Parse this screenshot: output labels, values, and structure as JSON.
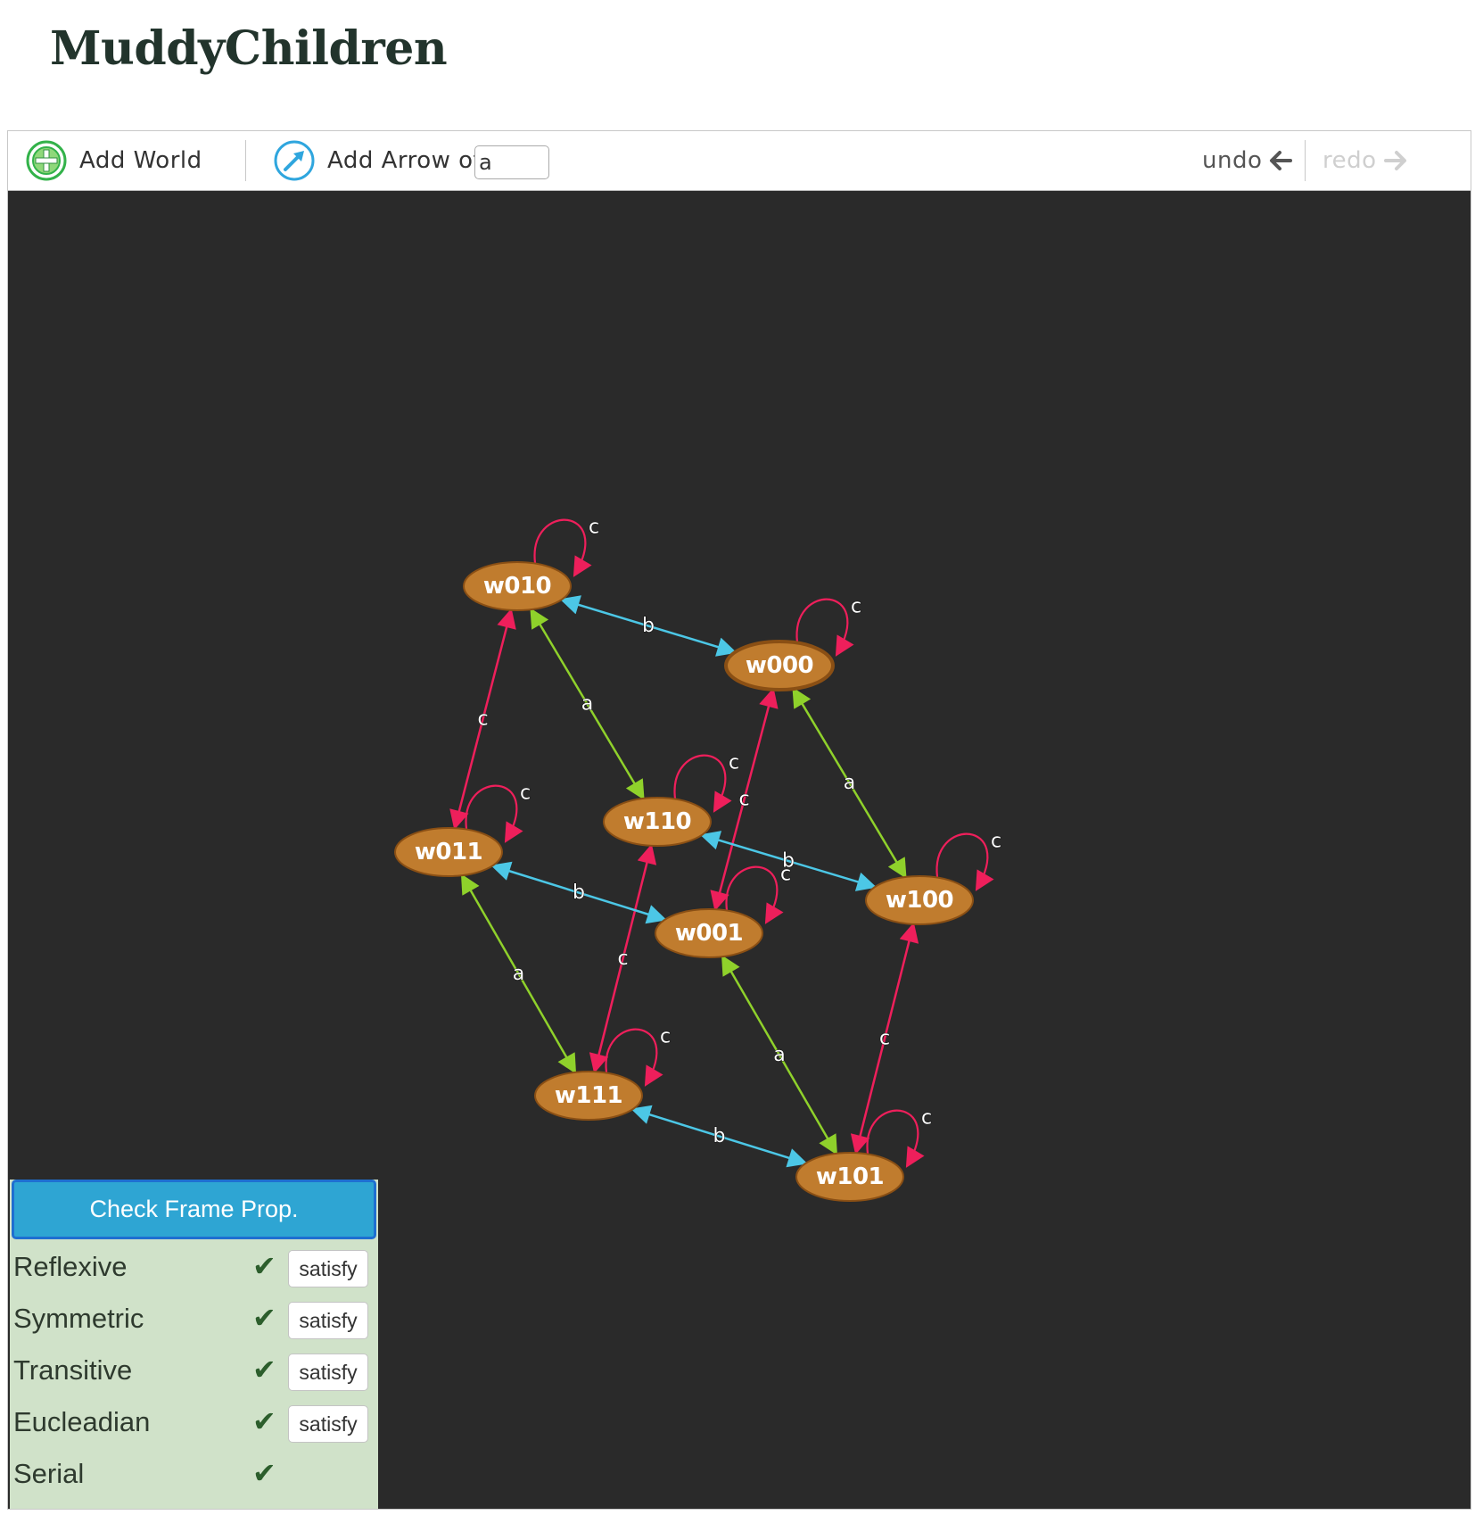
{
  "page": {
    "title": "MuddyChildren"
  },
  "toolbar": {
    "add_world_label": "Add World",
    "add_arrow_label": "Add Arrow of",
    "arrow_label_value": "a",
    "undo_label": "undo",
    "redo_label": "redo"
  },
  "colors": {
    "canvas_bg": "#2a2a2a",
    "world_fill": "#c07c2e",
    "world_stroke": "#8a4f14",
    "agent_a": "#8fd12b",
    "agent_b": "#4cc7e6",
    "agent_c": "#ee1f5b",
    "panel_bg": "#d0e2c9",
    "check_button": "#2ea5d3"
  },
  "graph": {
    "worlds": [
      {
        "id": "w010",
        "label": "w010"
      },
      {
        "id": "w000",
        "label": "w000",
        "selected": true
      },
      {
        "id": "w110",
        "label": "w110"
      },
      {
        "id": "w011",
        "label": "w011"
      },
      {
        "id": "w100",
        "label": "w100"
      },
      {
        "id": "w001",
        "label": "w001"
      },
      {
        "id": "w111",
        "label": "w111"
      },
      {
        "id": "w101",
        "label": "w101"
      }
    ],
    "edges": [
      {
        "from": "w010",
        "to": "w000",
        "label": "b",
        "bidirectional": true
      },
      {
        "from": "w010",
        "to": "w110",
        "label": "a",
        "bidirectional": true
      },
      {
        "from": "w010",
        "to": "w011",
        "label": "c",
        "bidirectional": true
      },
      {
        "from": "w000",
        "to": "w100",
        "label": "a",
        "bidirectional": true
      },
      {
        "from": "w000",
        "to": "w001",
        "label": "c",
        "bidirectional": true
      },
      {
        "from": "w110",
        "to": "w100",
        "label": "b",
        "bidirectional": true
      },
      {
        "from": "w110",
        "to": "w111",
        "label": "c",
        "bidirectional": true
      },
      {
        "from": "w011",
        "to": "w001",
        "label": "b",
        "bidirectional": true
      },
      {
        "from": "w011",
        "to": "w111",
        "label": "a",
        "bidirectional": true
      },
      {
        "from": "w001",
        "to": "w101",
        "label": "a",
        "bidirectional": true
      },
      {
        "from": "w100",
        "to": "w101",
        "label": "c",
        "bidirectional": true
      },
      {
        "from": "w111",
        "to": "w101",
        "label": "b",
        "bidirectional": true
      }
    ],
    "loops": [
      {
        "world": "w010",
        "label": "c"
      },
      {
        "world": "w000",
        "label": "c"
      },
      {
        "world": "w110",
        "label": "c"
      },
      {
        "world": "w011",
        "label": "c"
      },
      {
        "world": "w100",
        "label": "c"
      },
      {
        "world": "w001",
        "label": "c"
      },
      {
        "world": "w111",
        "label": "c"
      },
      {
        "world": "w101",
        "label": "c"
      }
    ]
  },
  "frame_panel": {
    "button_label": "Check Frame Prop.",
    "properties": [
      {
        "name": "Reflexive",
        "check": "✔",
        "action": "satisfy"
      },
      {
        "name": "Symmetric",
        "check": "✔",
        "action": "satisfy"
      },
      {
        "name": "Transitive",
        "check": "✔",
        "action": "satisfy"
      },
      {
        "name": "Eucleadian",
        "check": "✔",
        "action": "satisfy"
      },
      {
        "name": "Serial",
        "check": "✔",
        "action": ""
      }
    ]
  }
}
